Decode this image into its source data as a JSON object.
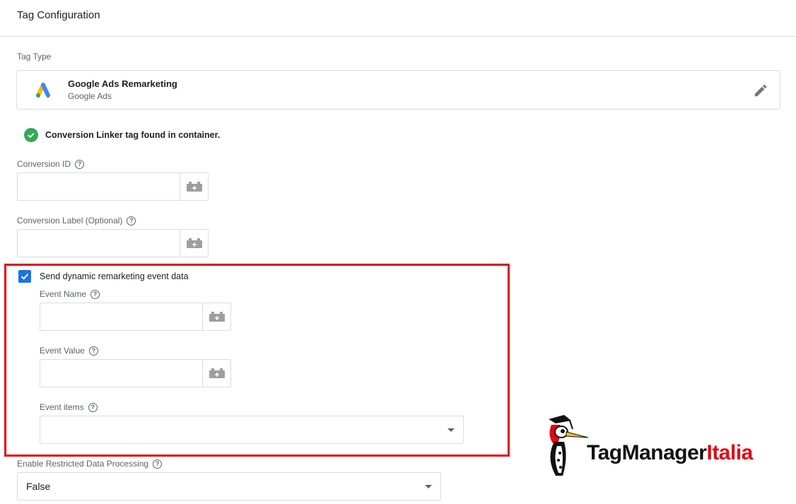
{
  "header": {
    "title": "Tag Configuration"
  },
  "tag_type": {
    "label": "Tag Type",
    "name": "Google Ads Remarketing",
    "vendor": "Google Ads",
    "icon": "google-ads-logo",
    "edit_icon": "pencil-icon"
  },
  "status": {
    "text": "Conversion Linker tag found in container.",
    "icon": "check-circle-icon",
    "color": "#34a853"
  },
  "fields": {
    "conversion_id": {
      "label": "Conversion ID",
      "value": ""
    },
    "conversion_label": {
      "label": "Conversion Label (Optional)",
      "value": ""
    }
  },
  "dynamic_remarketing": {
    "checkbox_label": "Send dynamic remarketing event data",
    "checked": true,
    "event_name": {
      "label": "Event Name",
      "value": ""
    },
    "event_value": {
      "label": "Event Value",
      "value": ""
    },
    "event_items": {
      "label": "Event items",
      "selected": ""
    }
  },
  "restricted_data": {
    "label": "Enable Restricted Data Processing",
    "selected": "False"
  },
  "watermark": {
    "part1": "TagManager",
    "part2": "Italia"
  },
  "colors": {
    "highlight": "#e30613",
    "checkbox": "#1a73e8",
    "border": "#dadce0",
    "muted_text": "#5f6368"
  }
}
